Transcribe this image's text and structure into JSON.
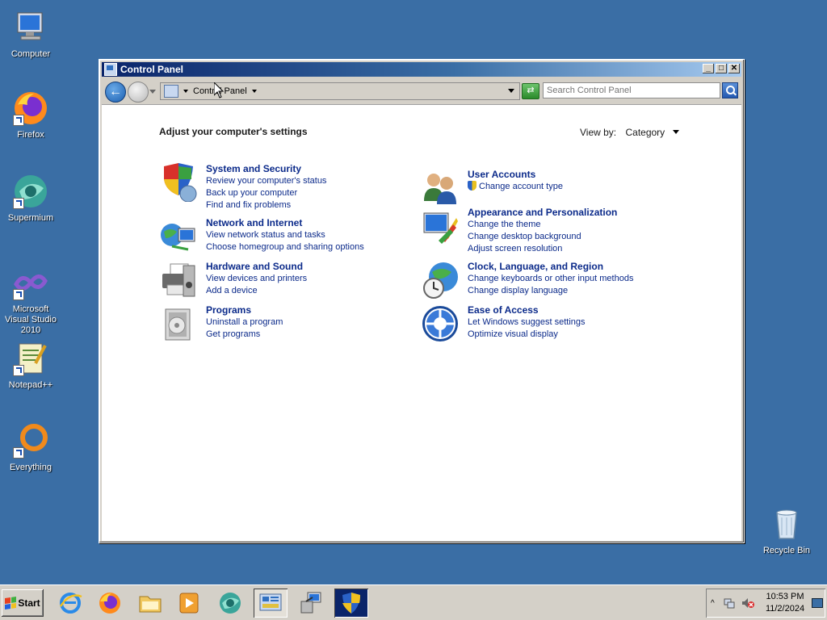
{
  "desktop": {
    "icons": [
      {
        "label": "Computer"
      },
      {
        "label": "Firefox"
      },
      {
        "label": "Supermium"
      },
      {
        "label": "Microsoft Visual Studio 2010"
      },
      {
        "label": "Notepad++"
      },
      {
        "label": "Everything"
      },
      {
        "label": "Recycle Bin"
      }
    ]
  },
  "window": {
    "title": "Control Panel",
    "controls": {
      "minimize": "_",
      "maximize": "□",
      "close": "✕"
    },
    "address": {
      "path": "Control Panel"
    },
    "search": {
      "placeholder": "Search Control Panel"
    }
  },
  "content": {
    "heading": "Adjust your computer's settings",
    "view_by": {
      "label": "View by:",
      "value": "Category"
    },
    "categories": [
      {
        "title": "System and Security",
        "links": [
          "Review your computer's status",
          "Back up your computer",
          "Find and fix problems"
        ],
        "icon": "shield-icon"
      },
      {
        "title": "Network and Internet",
        "links": [
          "View network status and tasks",
          "Choose homegroup and sharing options"
        ],
        "icon": "network-icon"
      },
      {
        "title": "Hardware and Sound",
        "links": [
          "View devices and printers",
          "Add a device"
        ],
        "icon": "printer-icon"
      },
      {
        "title": "Programs",
        "links": [
          "Uninstall a program",
          "Get programs"
        ],
        "icon": "programs-icon"
      },
      {
        "title": "User Accounts",
        "links": [
          "Change account type"
        ],
        "icon": "users-icon"
      },
      {
        "title": "Appearance and Personalization",
        "links": [
          "Change the theme",
          "Change desktop background",
          "Adjust screen resolution"
        ],
        "icon": "monitor-icon"
      },
      {
        "title": "Clock, Language, and Region",
        "links": [
          "Change keyboards or other input methods",
          "Change display language"
        ],
        "icon": "globe-clock-icon"
      },
      {
        "title": "Ease of Access",
        "links": [
          "Let Windows suggest settings",
          "Optimize visual display"
        ],
        "icon": "ease-of-access-icon"
      }
    ]
  },
  "taskbar": {
    "start_label": "Start",
    "clock": {
      "time": "10:53 PM",
      "date": "11/2/2024"
    },
    "tray_up": "^"
  }
}
